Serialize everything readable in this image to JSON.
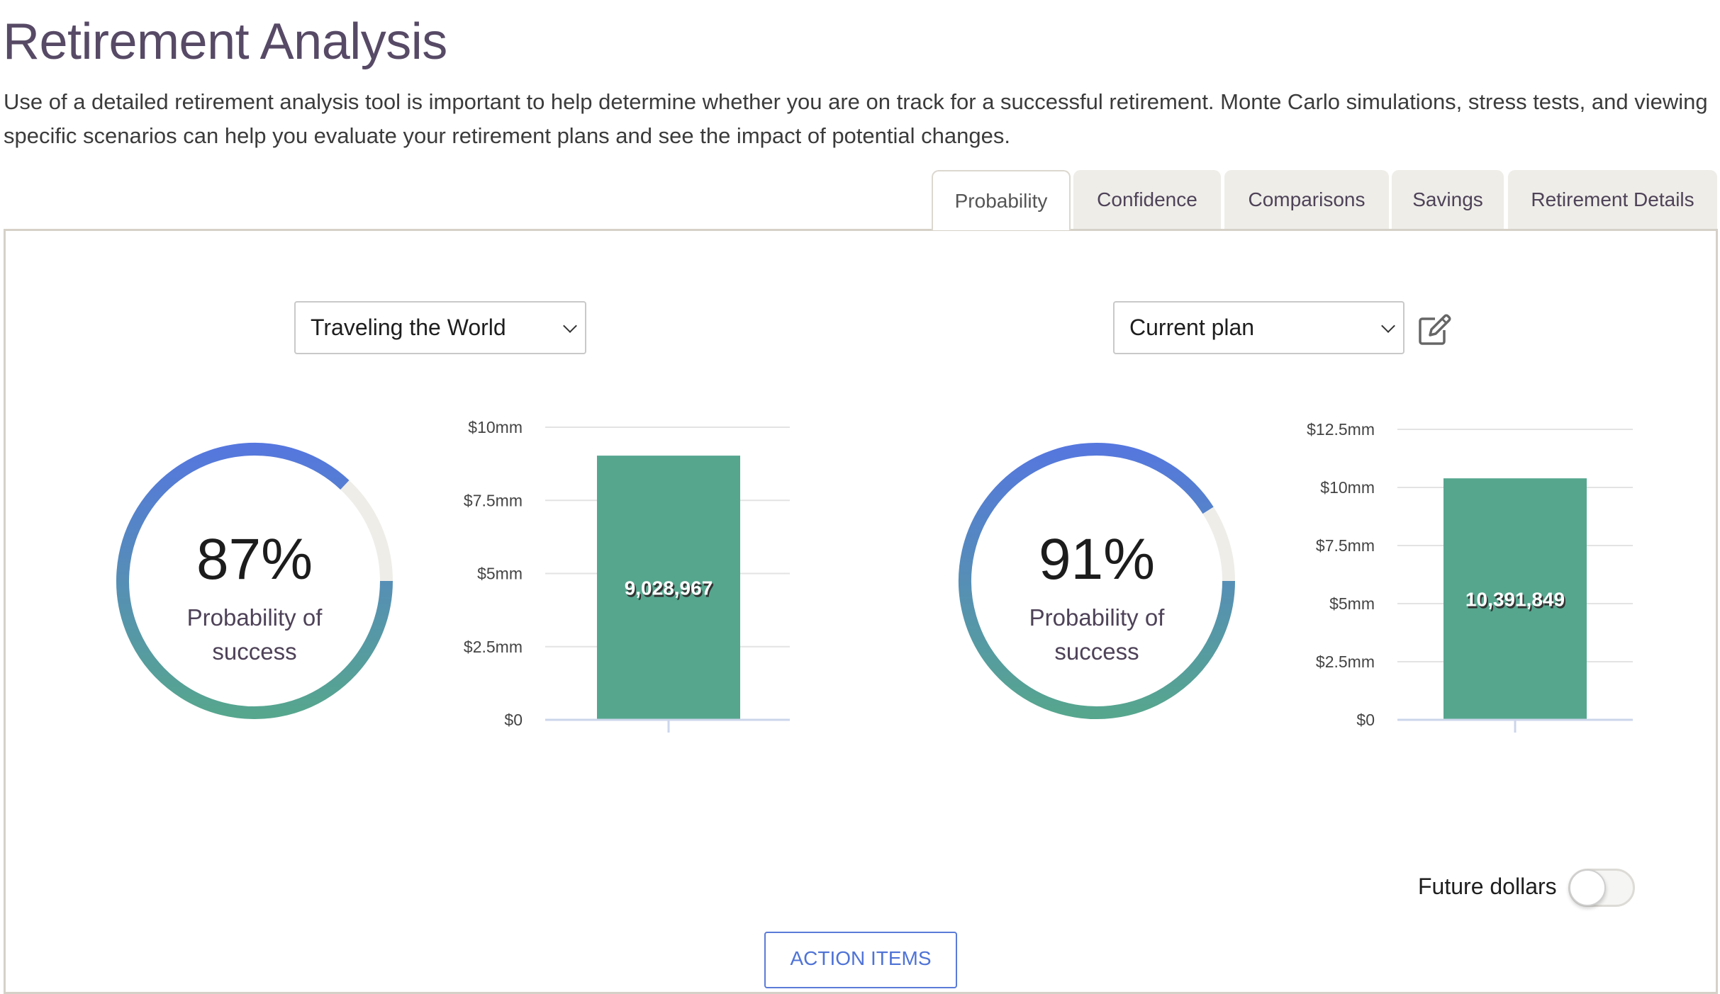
{
  "header": {
    "title": "Retirement Analysis",
    "description": "Use of a detailed retirement analysis tool is important to help determine whether you are on track for a successful retirement. Monte Carlo simulations, stress tests, and viewing specific scenarios can help you evaluate your retirement plans and see the impact of potential changes."
  },
  "tabs": [
    {
      "label": "Probability",
      "active": true
    },
    {
      "label": "Confidence",
      "active": false
    },
    {
      "label": "Comparisons",
      "active": false
    },
    {
      "label": "Savings",
      "active": false
    },
    {
      "label": "Retirement Details",
      "active": false
    }
  ],
  "colors": {
    "gradient_top": "#5577de",
    "gradient_bottom": "#56a68e",
    "ring_track": "#eeede8",
    "bar": "#56a68e",
    "accent": "#4f73d6",
    "title": "#574a66"
  },
  "scenarios": [
    {
      "select_value": "Traveling the World",
      "probability_percent": 87,
      "probability_text": "87%",
      "probability_label": "Probability of success",
      "has_edit": false
    },
    {
      "select_value": "Current plan",
      "probability_percent": 91,
      "probability_text": "91%",
      "probability_label": "Probability of success",
      "has_edit": true,
      "edit_icon": "edit-icon"
    }
  ],
  "chart_data": [
    {
      "type": "bar",
      "title": "",
      "xlabel": "",
      "ylabel": "",
      "categories": [
        ""
      ],
      "values": [
        9028967
      ],
      "value_labels": [
        "9,028,967"
      ],
      "ylim": [
        0,
        10000000
      ],
      "yticks": [
        0,
        2500000,
        5000000,
        7500000,
        10000000
      ],
      "ytick_labels": [
        "$0",
        "$2.5mm",
        "$5mm",
        "$7.5mm",
        "$10mm"
      ],
      "grid": true
    },
    {
      "type": "bar",
      "title": "",
      "xlabel": "",
      "ylabel": "",
      "categories": [
        ""
      ],
      "values": [
        10391849
      ],
      "value_labels": [
        "10,391,849"
      ],
      "ylim": [
        0,
        12500000
      ],
      "yticks": [
        0,
        2500000,
        5000000,
        7500000,
        10000000,
        12500000
      ],
      "ytick_labels": [
        "$0",
        "$2.5mm",
        "$5mm",
        "$7.5mm",
        "$10mm",
        "$12.5mm"
      ],
      "grid": true
    }
  ],
  "footer": {
    "future_dollars_label": "Future dollars",
    "future_dollars_on": false,
    "action_items_label": "ACTION ITEMS"
  }
}
